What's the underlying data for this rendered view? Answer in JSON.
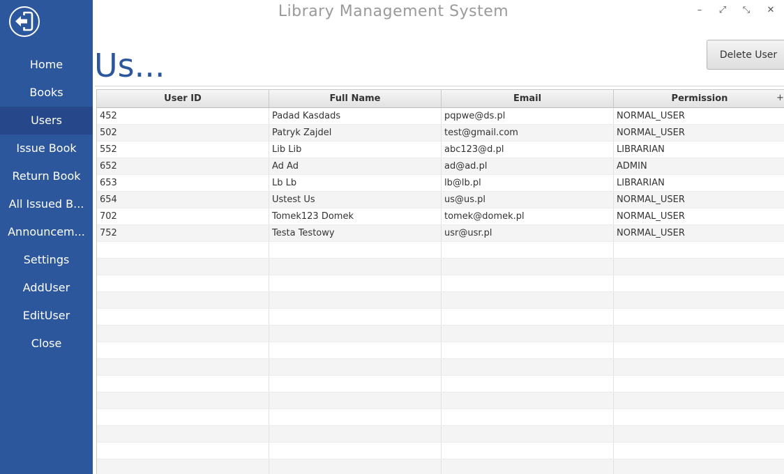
{
  "window": {
    "title": "Library Management System",
    "controls": [
      {
        "name": "minimize",
        "glyph": "–"
      },
      {
        "name": "restore",
        "glyph": "⤢"
      },
      {
        "name": "fullscreen",
        "glyph": "⤡"
      },
      {
        "name": "close",
        "glyph": "✕"
      }
    ]
  },
  "sidebar": {
    "back_icon": "back-arrow-icon",
    "items": [
      {
        "label": "Home",
        "active": false
      },
      {
        "label": "Books",
        "active": false
      },
      {
        "label": "Users",
        "active": true
      },
      {
        "label": "Issue Book",
        "active": false
      },
      {
        "label": "Return Book",
        "active": false
      },
      {
        "label": "All Issued B...",
        "active": false
      },
      {
        "label": "Announcem...",
        "active": false
      },
      {
        "label": "Settings",
        "active": false
      },
      {
        "label": "AddUser",
        "active": false
      },
      {
        "label": "EditUser",
        "active": false
      },
      {
        "label": "Close",
        "active": false
      }
    ]
  },
  "page": {
    "title": "Us...",
    "delete_label": "Delete User"
  },
  "table": {
    "column_menu_glyph": "+",
    "columns": [
      "User ID",
      "Full Name",
      "Email",
      "Permission"
    ],
    "rows": [
      [
        "452",
        "Padad Kasdads",
        "pqpwe@ds.pl",
        "NORMAL_USER"
      ],
      [
        "502",
        "Patryk Zajdel",
        "test@gmail.com",
        "NORMAL_USER"
      ],
      [
        "552",
        "Lib Lib",
        "abc123@d.pl",
        "LIBRARIAN"
      ],
      [
        "652",
        "Ad Ad",
        "ad@ad.pl",
        "ADMIN"
      ],
      [
        "653",
        "Lb Lb",
        "lb@lb.pl",
        "LIBRARIAN"
      ],
      [
        "654",
        "Ustest Us",
        "us@us.pl",
        "NORMAL_USER"
      ],
      [
        "702",
        "Tomek123 Domek",
        "tomek@domek.pl",
        "NORMAL_USER"
      ],
      [
        "752",
        "Testa Testowy",
        "usr@usr.pl",
        "NORMAL_USER"
      ]
    ]
  },
  "colors": {
    "sidebar": "#2c579d",
    "sidebar_active": "#26488a",
    "accent": "#2c579d"
  }
}
